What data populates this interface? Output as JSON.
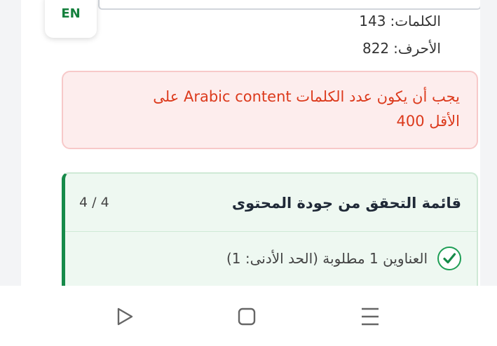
{
  "language_toggle": {
    "label": "EN"
  },
  "stats": {
    "words_label": "الكلمات:",
    "words_value": "143",
    "chars_label": "الأحرف:",
    "chars_value": "822"
  },
  "error": {
    "line1": "يجب أن يكون عدد الكلمات Arabic content على",
    "line2": "الأقل 400"
  },
  "checklist": {
    "title": "قائمة التحقق من جودة المحتوى",
    "count": "4 / 4",
    "items": [
      {
        "label": "العناوين 1 مطلوبة (الحد الأدنى: 1)",
        "checked": true
      }
    ]
  },
  "colors": {
    "accent_green": "#168a49",
    "error_red": "#dc3a1c",
    "error_bg": "#fdeded"
  },
  "navbar": {
    "icons": [
      "play-icon",
      "square-icon",
      "menu-icon"
    ]
  }
}
